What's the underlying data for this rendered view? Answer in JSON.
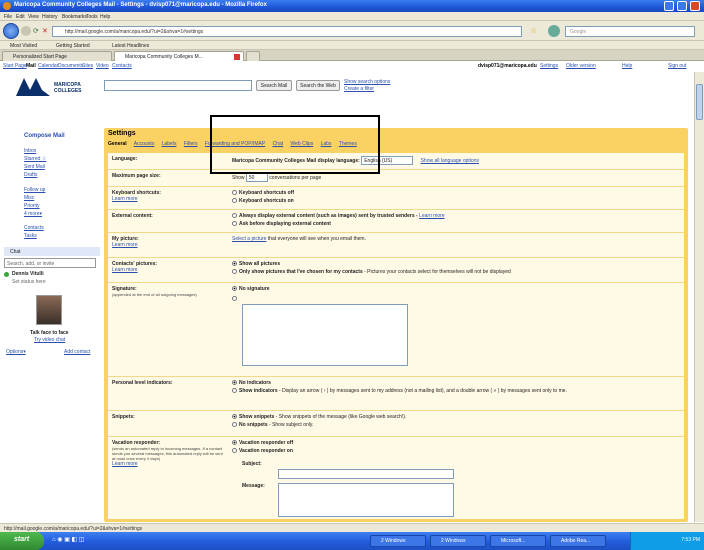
{
  "window": {
    "title": "Maricopa Community Colleges Mail - Settings - dvisp071@maricopa.edu - Mozilla Firefox"
  },
  "menu": [
    "File",
    "Edit",
    "View",
    "History",
    "Bookmarks",
    "Tools",
    "Help"
  ],
  "address_bar": {
    "url": "http://mail.google.com/a/maricopa.edu/?ui=2&shva=1#settings",
    "search_placeholder": "Google"
  },
  "bookmarks": [
    "Most Visited",
    "Getting Started",
    "Latest Headlines"
  ],
  "browser_tabs": [
    {
      "label": "Personalized Start Page",
      "active": false
    },
    {
      "label": "Maricopa Community Colleges M...",
      "active": true
    }
  ],
  "gmail_top": {
    "left_links": [
      "Start Page",
      "Mail",
      "Calendar",
      "Documents",
      "Sites",
      "Video",
      "Contacts"
    ],
    "user": "dvisp071@maricopa.edu",
    "right_links": [
      "Settings",
      "Older version",
      "Help",
      "Sign out"
    ]
  },
  "logo": {
    "text": "MARICOPA COLLEGES"
  },
  "search": {
    "search_mail": "Search Mail",
    "search_web": "Search the Web",
    "options": "Show search options",
    "create_filter": "Create a filter"
  },
  "left_nav": {
    "compose": "Compose Mail",
    "items": [
      "Inbox",
      "Starred ☆",
      "Sent Mail",
      "Drafts"
    ],
    "items2": [
      "Follow up",
      "Misc",
      "Priority",
      "4 more▾"
    ],
    "contacts": "Contacts",
    "tasks": "Tasks",
    "chat": "Chat",
    "chat_search": "Search, add, or invite",
    "status_name": "Dennis Vitulli",
    "status_text": "Set status here",
    "promo_title": "Talk face to face",
    "promo_link": "Try video chat",
    "options_link": "Options▾",
    "add_contact": "Add contact"
  },
  "settings": {
    "title": "Settings",
    "tabs": [
      {
        "label": "General",
        "active": true
      },
      {
        "label": "Accounts",
        "active": false
      },
      {
        "label": "Labels",
        "active": false
      },
      {
        "label": "Filters",
        "active": false
      },
      {
        "label": "Forwarding and POP/IMAP",
        "active": false
      },
      {
        "label": "Chat",
        "active": false
      },
      {
        "label": "Web Clips",
        "active": false
      },
      {
        "label": "Labs",
        "active": false
      },
      {
        "label": "Themes",
        "active": false
      }
    ],
    "rows": {
      "language": {
        "label": "Language:",
        "prefix": "Maricopa Community Colleges Mail display language:",
        "value": "English (US)",
        "link": "Show all language options"
      },
      "page_size": {
        "label": "Maximum page size:",
        "prefix": "Show",
        "value": "50",
        "suffix": "conversations per page"
      },
      "shortcuts": {
        "label": "Keyboard shortcuts:",
        "link": "Learn more",
        "opt1": "Keyboard shortcuts off",
        "opt2": "Keyboard shortcuts on"
      },
      "external": {
        "label": "External content:",
        "opt1": "Always display external content (such as images) sent by trusted senders -",
        "opt1_link": "Learn more",
        "opt2": "Ask before displaying external content"
      },
      "my_picture": {
        "label": "My picture:",
        "link": "Learn more",
        "select_link": "Select a picture",
        "text": "that everyone will see when you email them."
      },
      "contacts_pictures": {
        "label": "Contacts' pictures:",
        "link": "Learn more",
        "opt1": "Show all pictures",
        "opt2": "Only show pictures that I've chosen for my contacts",
        "opt2_tail": "- Pictures your contacts select for themselves will not be displayed"
      },
      "signature": {
        "label": "Signature:",
        "note": "(appended at the end of all outgoing messages)",
        "opt1": "No signature"
      },
      "personal_indicators": {
        "label": "Personal level indicators:",
        "opt1": "No indicators",
        "opt2": "Show indicators",
        "opt2_tail": "- Display an arrow ( › ) by messages sent to my address (not a mailing list), and a double arrow ( » ) by messages sent only to me."
      },
      "snippets": {
        "label": "Snippets:",
        "opt1": "Show snippets",
        "opt1_tail": "- Show snippets of the message (like Google web search!).",
        "opt2": "No snippets",
        "opt2_tail": "- Show subject only."
      },
      "vacation": {
        "label": "Vacation responder:",
        "note": "(sends an automated reply to incoming messages. If a contact sends you several messages, this automated reply will be sent at most once every 4 days)",
        "link": "Learn more",
        "opt1": "Vacation responder off",
        "opt2": "Vacation responder on",
        "subject": "Subject:",
        "message": "Message:"
      }
    }
  },
  "status_bar": "http://mail.google.com/a/maricopa.edu/?ui=2&shva=1#settings",
  "taskbar": {
    "start": "start",
    "items": [
      "2 Windows",
      "2 Windows",
      "Microsoft...",
      "Adobe Rea..."
    ],
    "time": "7:53 PM"
  }
}
